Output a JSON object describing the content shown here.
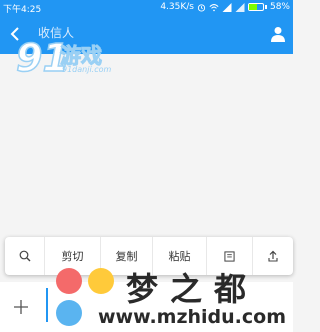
{
  "status_bar": {
    "time": "下午4:25",
    "speed": "4.35K/s",
    "battery": "58%",
    "battery_level": 0.58
  },
  "header": {
    "title": "收信人"
  },
  "watermark_top": {
    "number": "91",
    "name": "游戏",
    "url": "91danji.com"
  },
  "toolbar": {
    "items": [
      "剪切",
      "复制",
      "粘贴"
    ]
  },
  "watermark_bottom": {
    "brand": "梦之都",
    "url": "www.mzhidu.com"
  },
  "colors": {
    "accent": "#2196f3",
    "battery_fill": "#7CFC00"
  }
}
